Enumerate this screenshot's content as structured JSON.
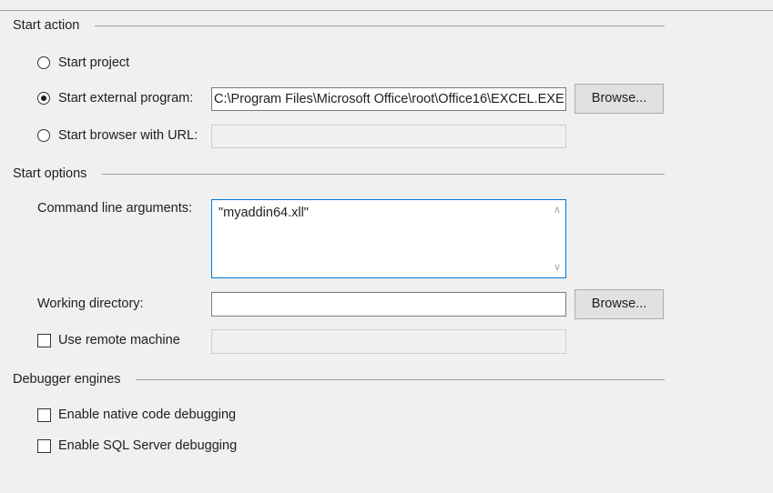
{
  "sections": {
    "start_action": "Start action",
    "start_options": "Start options",
    "debugger_engines": "Debugger engines"
  },
  "start_action": {
    "start_project": {
      "label": "Start project",
      "checked": false
    },
    "start_external": {
      "label": "Start external program:",
      "checked": true,
      "value": "C:\\Program Files\\Microsoft Office\\root\\Office16\\EXCEL.EXE"
    },
    "start_browser": {
      "label": "Start browser with URL:",
      "checked": false,
      "value": ""
    },
    "browse_label": "Browse..."
  },
  "start_options": {
    "cmd_label": "Command line arguments:",
    "cmd_value": "\"myaddin64.xll\"",
    "workdir_label": "Working directory:",
    "workdir_value": "",
    "browse_label": "Browse...",
    "remote_label": "Use remote machine",
    "remote_checked": false,
    "remote_value": ""
  },
  "debugger_engines": {
    "native": {
      "label": "Enable native code debugging",
      "checked": false
    },
    "sql": {
      "label": "Enable SQL Server debugging",
      "checked": false
    }
  },
  "icons": {
    "scroll_up": "chevron-up-icon",
    "scroll_down": "chevron-down-icon"
  },
  "colors": {
    "focus_border": "#0078d7",
    "background": "#f0f0f0"
  }
}
